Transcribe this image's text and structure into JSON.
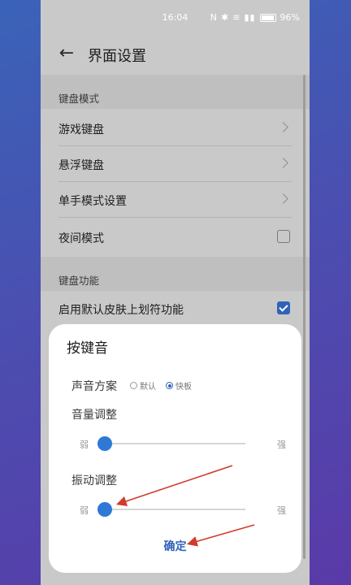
{
  "status_bar": {
    "time": "16:04",
    "battery": "96%"
  },
  "header": {
    "title": "界面设置"
  },
  "sections": [
    {
      "title": "键盘模式"
    },
    {
      "title": "键盘功能"
    }
  ],
  "rows": [
    {
      "label": "游戏键盘"
    },
    {
      "label": "悬浮键盘"
    },
    {
      "label": "单手模式设置"
    },
    {
      "label": "夜间模式"
    },
    {
      "label": "启用默认皮肤上划符功能"
    }
  ],
  "dialog": {
    "title": "按键音",
    "sound_scheme_label": "声音方案",
    "options": [
      "默认",
      "快板"
    ],
    "selected_option": "快板",
    "volume_label": "音量调整",
    "vibration_label": "振动调整",
    "slider_low": "弱",
    "slider_high": "强",
    "volume_level": 0,
    "vibration_level": 0,
    "confirm_label": "确定"
  },
  "colors": {
    "accent": "#2e63b8",
    "slider_thumb": "#2e78d6",
    "annotation": "#d23a2a"
  },
  "icons": {
    "back": "back-arrow-icon",
    "chevron": "chevron-right-icon",
    "checkbox": "checkbox-icon"
  }
}
